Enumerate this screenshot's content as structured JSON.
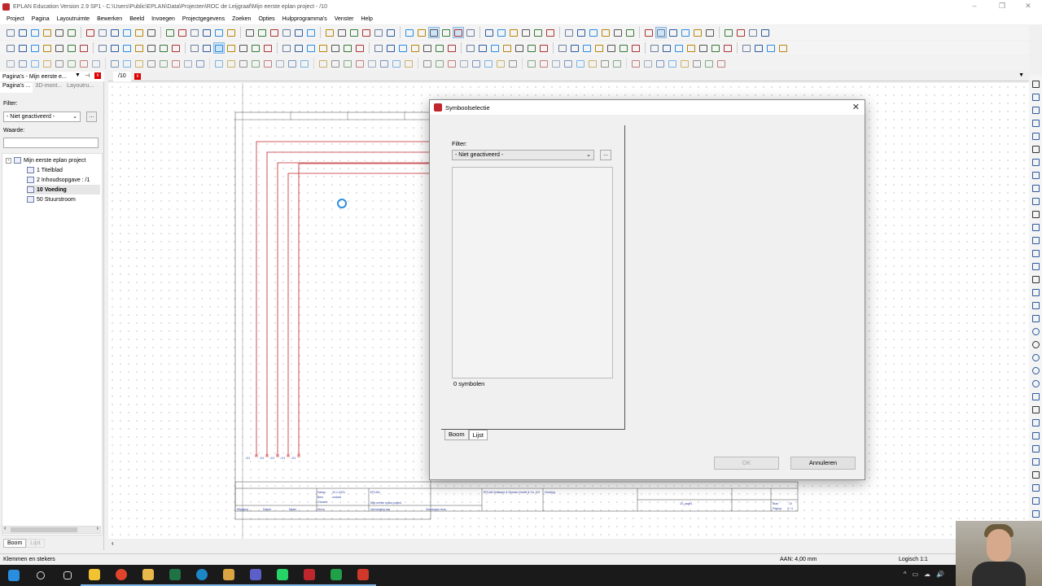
{
  "window": {
    "title": "EPLAN Education Version 2.9 SP1 - C:\\Users\\Public\\EPLAN\\Data\\Projecten\\ROC de Leijgraaf\\Mijn eerste eplan project - /10",
    "min": "–",
    "max": "❐",
    "close": "✕"
  },
  "menu": [
    "Project",
    "Pagina",
    "Layoutruimte",
    "Bewerken",
    "Beeld",
    "Invoegen",
    "Projectgegevens",
    "Zoeken",
    "Opties",
    "Hulpprogramma's",
    "Venster",
    "Help"
  ],
  "page_panel": {
    "title": "Pagina's - Mijn eerste e...",
    "tabs": [
      "Pagina's ...",
      "3D-mont...",
      "Layoutru..."
    ],
    "filter_label": "Filter:",
    "filter_value": "- Niet geactiveerd -",
    "dots": "...",
    "value_label": "Waarde:",
    "value_input": "",
    "tree": {
      "root": "Mijn eerste eplan project",
      "children": [
        "1 Titelblad",
        "2 Inhoudsopgave : /1",
        "10 Voeding",
        "50 Stuurstroom"
      ]
    },
    "bottom_tabs": [
      "Boom",
      "Lijst"
    ]
  },
  "doc_tab": {
    "label": "/10",
    "close": "x"
  },
  "status": {
    "left": "Klemmen en stekers",
    "middle": "AAN: 4,00 mm",
    "right": "Logisch 1:1"
  },
  "dialog": {
    "title": "Symboolselectie",
    "close": "✕",
    "filter_label": "Filter:",
    "filter_value": "- Niet geactiveerd -",
    "dots": "...",
    "count_text": "0 symbolen",
    "tabs": [
      "Boom",
      "Lijst"
    ],
    "ok_label": "OK",
    "cancel_label": "Annuleren"
  },
  "drawing": {
    "title_block": {
      "company": "EPLAN",
      "project": "Mijn eerste eplan project",
      "address": "EPLAN Software & Service GmbH & Co. KG",
      "page_desc": "Voeding",
      "date_label": "Datum",
      "date": "22-1-2021",
      "edited_label": "Bew.",
      "edited": "ondrad",
      "checked_label": "Gecontr.",
      "change_label": "Wijziging",
      "datum2": "Datum",
      "name_label": "Naam",
      "norm_label": "Norm",
      "replaced_by": "Vervanging van",
      "replaced_for": "Vervangen door",
      "page_label": "Blad",
      "page_no": "10",
      "pages_label": "Pagina",
      "pages": "3 / 4",
      "code": "10_page1"
    },
    "wire_labels": [
      "-X1",
      "-X1",
      "-X1",
      "-X1",
      "-X1"
    ]
  },
  "taskbar": {
    "icons": [
      "windows-start",
      "search",
      "task-view",
      "file-explorer-yellow",
      "chrome",
      "folder",
      "excel",
      "edge",
      "documents",
      "teams",
      "whatsapp",
      "eplan",
      "green-app",
      "red-app"
    ],
    "tray": [
      "^",
      "▭",
      "☁",
      "🔊"
    ]
  }
}
